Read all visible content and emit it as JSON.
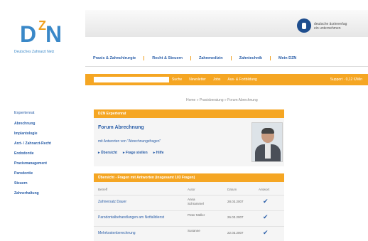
{
  "logo": {
    "letter_d": "D",
    "letter_z": "Z",
    "letter_n": "N",
    "subtitle": "Deutsches Zahnarzt Netz"
  },
  "brand": {
    "line1": "deutsche ärzteverlag",
    "line2": "ein unternehmen"
  },
  "nav": {
    "items": [
      "Praxis & Zahnchirurgie",
      "Recht & Steuern",
      "Zahnmedizin",
      "Zahntechnik",
      "Mein DZN"
    ]
  },
  "toolbar": {
    "search_placeholder": "",
    "search_label": "Suche",
    "links": [
      "Newsletter",
      "Jobs",
      "Aus- & Fortbildung"
    ],
    "right_link": "Support · 0,12 €/Min"
  },
  "breadcrumb": "Home » Praxisberatung » Forum Abrechnung",
  "sidebar": {
    "title": "Expertenrat",
    "items": [
      "Abrechnung",
      "Implantologie",
      "Arzt- / Zahnarzt-Recht",
      "Endodontie",
      "Praxismanagement",
      "Parodontie",
      "Steuern",
      "Zahnerhaltung"
    ]
  },
  "expert_panel": {
    "header": "DZN Expertenrat",
    "title": "Forum Abrechnung",
    "text": "mit Antworten von \"Abrechnungsfragen\"",
    "actions": [
      "Übersicht",
      "Frage stellen",
      "Hilfe"
    ]
  },
  "questions_panel": {
    "header": "Übersicht - Fragen mit Antworten (insgesamt 103 Fragen)",
    "columns": [
      "Betreff",
      "Autor",
      "Datum",
      "Antwort"
    ],
    "rows": [
      {
        "title": "Zahnersatz Dauer",
        "author": "Anna Schrammel",
        "date": "28.03.2007"
      },
      {
        "title": "Parodontalbehandlungen am Notfalldienst",
        "author": "Peter Müller",
        "date": "26.03.2007"
      },
      {
        "title": "Mehrkostenberechnung",
        "author": "Susanne",
        "date": "22.03.2007"
      }
    ]
  }
}
